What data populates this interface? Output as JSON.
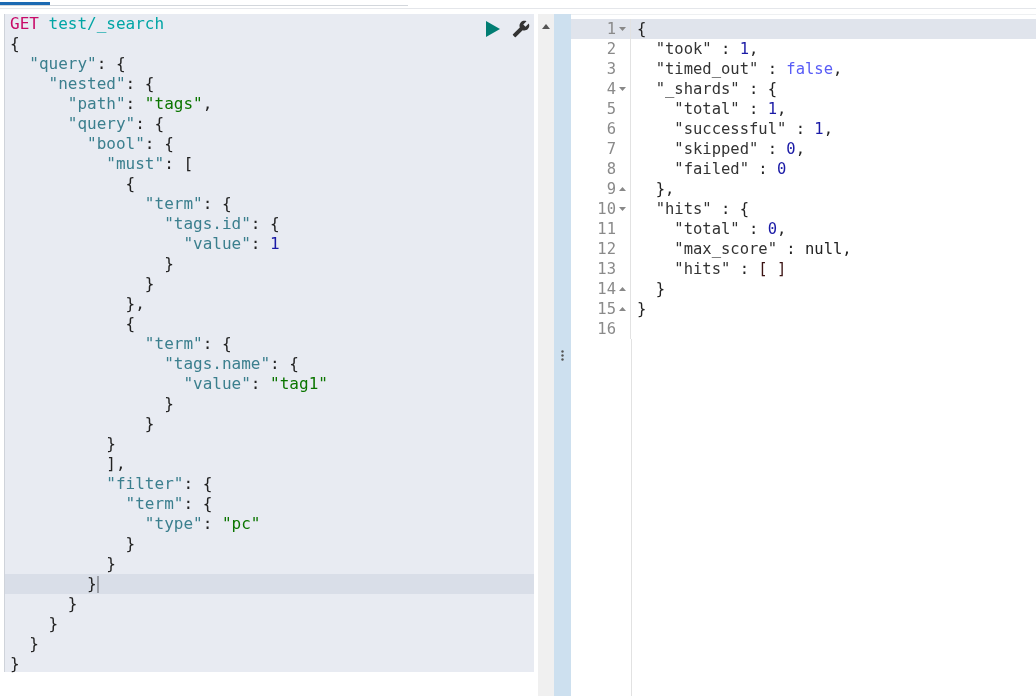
{
  "request_editor": {
    "lines": [
      {
        "active": false,
        "tokens": [
          {
            "kind": "method",
            "text": "GET"
          },
          {
            "kind": "url",
            "text": "test/_search"
          }
        ]
      },
      {
        "active": false,
        "tokens": [
          {
            "kind": "punct",
            "text": "{"
          }
        ]
      },
      {
        "active": false,
        "tokens": [
          {
            "kind": "key",
            "text": "  \"query\""
          },
          {
            "kind": "punct",
            "text": ": {"
          }
        ]
      },
      {
        "active": false,
        "tokens": [
          {
            "kind": "key",
            "text": "    \"nested\""
          },
          {
            "kind": "punct",
            "text": ": {"
          }
        ]
      },
      {
        "active": false,
        "tokens": [
          {
            "kind": "key",
            "text": "      \"path\""
          },
          {
            "kind": "punct",
            "text": ": "
          },
          {
            "kind": "string",
            "text": "\"tags\""
          },
          {
            "kind": "punct",
            "text": ","
          }
        ]
      },
      {
        "active": false,
        "tokens": [
          {
            "kind": "key",
            "text": "      \"query\""
          },
          {
            "kind": "punct",
            "text": ": {"
          }
        ]
      },
      {
        "active": false,
        "tokens": [
          {
            "kind": "key",
            "text": "        \"bool\""
          },
          {
            "kind": "punct",
            "text": ": {"
          }
        ]
      },
      {
        "active": false,
        "tokens": [
          {
            "kind": "key",
            "text": "          \"must\""
          },
          {
            "kind": "punct",
            "text": ": ["
          }
        ]
      },
      {
        "active": false,
        "tokens": [
          {
            "kind": "punct",
            "text": "            {"
          }
        ]
      },
      {
        "active": false,
        "tokens": [
          {
            "kind": "key",
            "text": "              \"term\""
          },
          {
            "kind": "punct",
            "text": ": {"
          }
        ]
      },
      {
        "active": false,
        "tokens": [
          {
            "kind": "key",
            "text": "                \"tags.id\""
          },
          {
            "kind": "punct",
            "text": ": {"
          }
        ]
      },
      {
        "active": false,
        "tokens": [
          {
            "kind": "key",
            "text": "                  \"value\""
          },
          {
            "kind": "punct",
            "text": ": "
          },
          {
            "kind": "number",
            "text": "1"
          }
        ]
      },
      {
        "active": false,
        "tokens": [
          {
            "kind": "punct",
            "text": "                }"
          }
        ]
      },
      {
        "active": false,
        "tokens": [
          {
            "kind": "punct",
            "text": "              }"
          }
        ]
      },
      {
        "active": false,
        "tokens": [
          {
            "kind": "punct",
            "text": "            },"
          }
        ]
      },
      {
        "active": false,
        "tokens": [
          {
            "kind": "punct",
            "text": "            {"
          }
        ]
      },
      {
        "active": false,
        "tokens": [
          {
            "kind": "key",
            "text": "              \"term\""
          },
          {
            "kind": "punct",
            "text": ": {"
          }
        ]
      },
      {
        "active": false,
        "tokens": [
          {
            "kind": "key",
            "text": "                \"tags.name\""
          },
          {
            "kind": "punct",
            "text": ": {"
          }
        ]
      },
      {
        "active": false,
        "tokens": [
          {
            "kind": "key",
            "text": "                  \"value\""
          },
          {
            "kind": "punct",
            "text": ": "
          },
          {
            "kind": "string",
            "text": "\"tag1\""
          }
        ]
      },
      {
        "active": false,
        "tokens": [
          {
            "kind": "punct",
            "text": "                }"
          }
        ]
      },
      {
        "active": false,
        "tokens": [
          {
            "kind": "punct",
            "text": "              }"
          }
        ]
      },
      {
        "active": false,
        "tokens": [
          {
            "kind": "punct",
            "text": "          }"
          }
        ]
      },
      {
        "active": false,
        "tokens": [
          {
            "kind": "punct",
            "text": "          ],"
          }
        ]
      },
      {
        "active": false,
        "tokens": [
          {
            "kind": "key",
            "text": "          \"filter\""
          },
          {
            "kind": "punct",
            "text": ": {"
          }
        ]
      },
      {
        "active": false,
        "tokens": [
          {
            "kind": "key",
            "text": "            \"term\""
          },
          {
            "kind": "punct",
            "text": ": {"
          }
        ]
      },
      {
        "active": false,
        "tokens": [
          {
            "kind": "key",
            "text": "              \"type\""
          },
          {
            "kind": "punct",
            "text": ": "
          },
          {
            "kind": "string",
            "text": "\"pc\""
          }
        ]
      },
      {
        "active": false,
        "tokens": [
          {
            "kind": "punct",
            "text": "            }"
          }
        ]
      },
      {
        "active": false,
        "tokens": [
          {
            "kind": "punct",
            "text": "          }"
          }
        ]
      },
      {
        "active": true,
        "tokens": [
          {
            "kind": "punct",
            "text": "        }"
          }
        ]
      },
      {
        "active": false,
        "tokens": [
          {
            "kind": "punct",
            "text": "      }"
          }
        ]
      },
      {
        "active": false,
        "tokens": [
          {
            "kind": "punct",
            "text": "    }"
          }
        ]
      },
      {
        "active": false,
        "tokens": [
          {
            "kind": "punct",
            "text": "  }"
          }
        ]
      },
      {
        "active": false,
        "tokens": [
          {
            "kind": "punct",
            "text": "}"
          }
        ]
      }
    ]
  },
  "response_editor": {
    "lines": [
      {
        "number": "1",
        "fold_start": true,
        "fold_end": false,
        "active": true,
        "tokens": [
          {
            "kind": "punct",
            "text": "{"
          }
        ]
      },
      {
        "number": "2",
        "fold_start": false,
        "fold_end": false,
        "active": false,
        "tokens": [
          {
            "kind": "key",
            "text": "  \"took\""
          },
          {
            "kind": "punct",
            "text": " : "
          },
          {
            "kind": "number",
            "text": "1"
          },
          {
            "kind": "punct",
            "text": ","
          }
        ]
      },
      {
        "number": "3",
        "fold_start": false,
        "fold_end": false,
        "active": false,
        "tokens": [
          {
            "kind": "key",
            "text": "  \"timed_out\""
          },
          {
            "kind": "punct",
            "text": " : "
          },
          {
            "kind": "boolean",
            "text": "false"
          },
          {
            "kind": "punct",
            "text": ","
          }
        ]
      },
      {
        "number": "4",
        "fold_start": true,
        "fold_end": false,
        "active": false,
        "tokens": [
          {
            "kind": "key",
            "text": "  \"_shards\""
          },
          {
            "kind": "punct",
            "text": " : {"
          }
        ]
      },
      {
        "number": "5",
        "fold_start": false,
        "fold_end": false,
        "active": false,
        "tokens": [
          {
            "kind": "key",
            "text": "    \"total\""
          },
          {
            "kind": "punct",
            "text": " : "
          },
          {
            "kind": "number",
            "text": "1"
          },
          {
            "kind": "punct",
            "text": ","
          }
        ]
      },
      {
        "number": "6",
        "fold_start": false,
        "fold_end": false,
        "active": false,
        "tokens": [
          {
            "kind": "key",
            "text": "    \"successful\""
          },
          {
            "kind": "punct",
            "text": " : "
          },
          {
            "kind": "number",
            "text": "1"
          },
          {
            "kind": "punct",
            "text": ","
          }
        ]
      },
      {
        "number": "7",
        "fold_start": false,
        "fold_end": false,
        "active": false,
        "tokens": [
          {
            "kind": "key",
            "text": "    \"skipped\""
          },
          {
            "kind": "punct",
            "text": " : "
          },
          {
            "kind": "number",
            "text": "0"
          },
          {
            "kind": "punct",
            "text": ","
          }
        ]
      },
      {
        "number": "8",
        "fold_start": false,
        "fold_end": false,
        "active": false,
        "tokens": [
          {
            "kind": "key",
            "text": "    \"failed\""
          },
          {
            "kind": "punct",
            "text": " : "
          },
          {
            "kind": "number",
            "text": "0"
          }
        ]
      },
      {
        "number": "9",
        "fold_start": false,
        "fold_end": true,
        "active": false,
        "tokens": [
          {
            "kind": "punct",
            "text": "  },"
          }
        ]
      },
      {
        "number": "10",
        "fold_start": true,
        "fold_end": false,
        "active": false,
        "tokens": [
          {
            "kind": "key",
            "text": "  \"hits\""
          },
          {
            "kind": "punct",
            "text": " : {"
          }
        ]
      },
      {
        "number": "11",
        "fold_start": false,
        "fold_end": false,
        "active": false,
        "tokens": [
          {
            "kind": "key",
            "text": "    \"total\""
          },
          {
            "kind": "punct",
            "text": " : "
          },
          {
            "kind": "number",
            "text": "0"
          },
          {
            "kind": "punct",
            "text": ","
          }
        ]
      },
      {
        "number": "12",
        "fold_start": false,
        "fold_end": false,
        "active": false,
        "tokens": [
          {
            "kind": "key",
            "text": "    \"max_score\""
          },
          {
            "kind": "punct",
            "text": " : "
          },
          {
            "kind": "null",
            "text": "null"
          },
          {
            "kind": "punct",
            "text": ","
          }
        ]
      },
      {
        "number": "13",
        "fold_start": false,
        "fold_end": false,
        "active": false,
        "tokens": [
          {
            "kind": "key",
            "text": "    \"hits\""
          },
          {
            "kind": "punct",
            "text": " : "
          },
          {
            "kind": "bracket",
            "text": "[ ]"
          }
        ]
      },
      {
        "number": "14",
        "fold_start": false,
        "fold_end": true,
        "active": false,
        "tokens": [
          {
            "kind": "punct",
            "text": "  }"
          }
        ]
      },
      {
        "number": "15",
        "fold_start": false,
        "fold_end": true,
        "active": false,
        "tokens": [
          {
            "kind": "punct",
            "text": "}"
          }
        ]
      },
      {
        "number": "16",
        "fold_start": false,
        "fold_end": false,
        "active": false
      }
    ]
  }
}
